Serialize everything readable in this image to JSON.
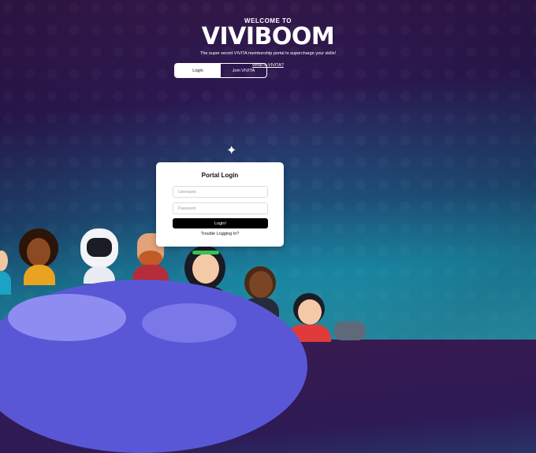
{
  "header": {
    "welcome": "WELCOME TO",
    "brand": "VIVIBOOM",
    "tagline": "The super secret VIVITA membership portal to supercharge your skills!",
    "what_is_link": "What is VIVITA?"
  },
  "toggle": {
    "login_label": "Login",
    "join_label": "Join VIVITA",
    "selected": "Login"
  },
  "login_card": {
    "title": "Portal Login",
    "username_placeholder": "Username",
    "password_placeholder": "Password",
    "login_button": "Login!",
    "trouble_link": "Trouble Logging In?"
  },
  "icons": {
    "sparkle": "sparkle-icon"
  },
  "colors": {
    "bg_top": "#3a1a4e",
    "bg_bottom": "#2ec6d6",
    "planet": "#5a57d6",
    "button": "#000000"
  }
}
